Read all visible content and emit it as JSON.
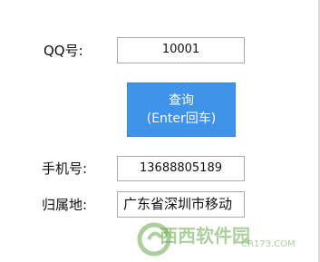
{
  "form": {
    "qq_label": "QQ号:",
    "qq_value": "10001",
    "query_button": {
      "line1": "查询",
      "line2": "(Enter回车)"
    },
    "phone_label": "手机号:",
    "phone_value": "13688805189",
    "location_label": "归属地:",
    "location_value": "广东省深圳市移动"
  },
  "watermark": {
    "brand": "西西软件园",
    "url": "CR173.COM"
  },
  "colors": {
    "button_bg": "#3f93e8",
    "field_border": "#a9a9a9",
    "watermark": "#6aa84f"
  }
}
